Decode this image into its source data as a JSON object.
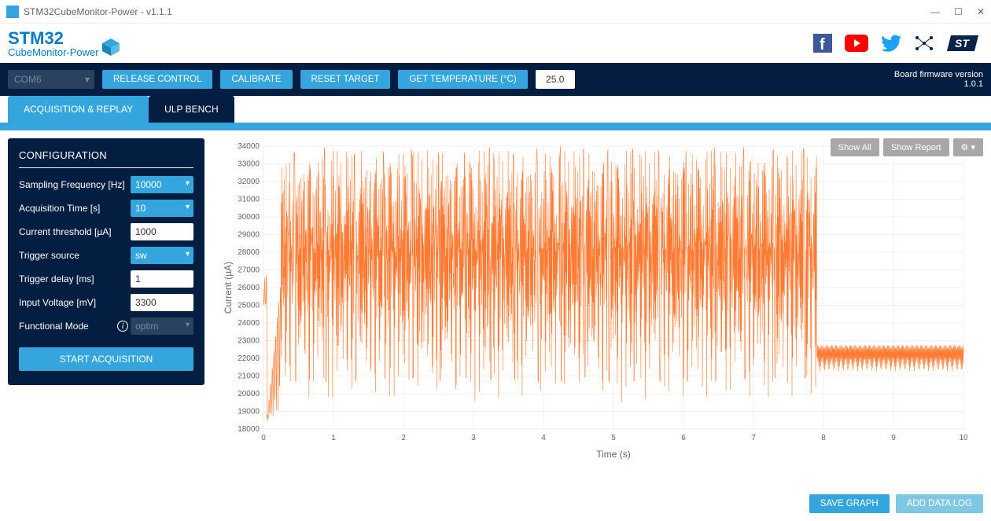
{
  "window": {
    "title": "STM32CubeMonitor-Power - v1.1.1"
  },
  "logo": {
    "line1": "STM32",
    "line2": "CubeMonitor-Power"
  },
  "toolbar": {
    "port": "COM6",
    "release": "RELEASE CONTROL",
    "calibrate": "CALIBRATE",
    "reset": "RESET TARGET",
    "gettemp": "GET TEMPERATURE (°C)",
    "temp_value": "25.0",
    "fw_label": "Board firmware version",
    "fw_version": "1.0.1"
  },
  "tabs": {
    "acq": "ACQUISITION & REPLAY",
    "ulp": "ULP BENCH"
  },
  "config": {
    "title": "CONFIGURATION",
    "rows": {
      "freq_label": "Sampling Frequency [Hz]",
      "freq_value": "10000",
      "time_label": "Acquisition Time [s]",
      "time_value": "10",
      "thresh_label": "Current threshold [µA]",
      "thresh_value": "1000",
      "trig_label": "Trigger source",
      "trig_value": "sw",
      "delay_label": "Trigger delay [ms]",
      "delay_value": "1",
      "volt_label": "Input Voltage [mV]",
      "volt_value": "3300",
      "mode_label": "Functional Mode",
      "mode_value": "optim"
    },
    "start": "START ACQUISITION"
  },
  "chart_buttons": {
    "showall": "Show All",
    "showreport": "Show Report"
  },
  "chart_data": {
    "type": "line",
    "title": "",
    "xlabel": "Time (s)",
    "ylabel": "Current (µA)",
    "xlim": [
      0,
      10
    ],
    "ylim": [
      18000,
      34000
    ],
    "yticks": [
      18000,
      19000,
      20000,
      21000,
      22000,
      23000,
      24000,
      25000,
      26000,
      27000,
      28000,
      29000,
      30000,
      31000,
      32000,
      33000,
      34000
    ],
    "xticks": [
      0,
      1,
      2,
      3,
      4,
      5,
      6,
      7,
      8,
      9,
      10
    ],
    "series": [
      {
        "name": "current",
        "description": "Noisy current waveform. From ~t=0 brief dip toward 18-20 mA then rises. From t≈0.25 s to t≈7.9 s the signal oscillates rapidly with mean ≈26500 µA, typical swing between ≈21000 and ≈31000 µA, with occasional tall narrow spikes up to ≈34000 µA (roughly 20 such spikes). At t≈7.9 s the regime changes: mean drops to ≈22000 µA with small-amplitude noise (≈21000–22500 µA) continuing flat to t=10 s.",
        "phase1": {
          "t_start": 0.25,
          "t_end": 7.9,
          "mean": 26500,
          "low": 21000,
          "high": 31000,
          "spike_max": 34000,
          "spike_count_approx": 20
        },
        "phase2": {
          "t_start": 7.9,
          "t_end": 10.0,
          "mean": 22000,
          "low": 21000,
          "high": 22500
        }
      }
    ]
  },
  "bottom": {
    "save": "SAVE GRAPH",
    "addlog": "ADD DATA LOG"
  }
}
